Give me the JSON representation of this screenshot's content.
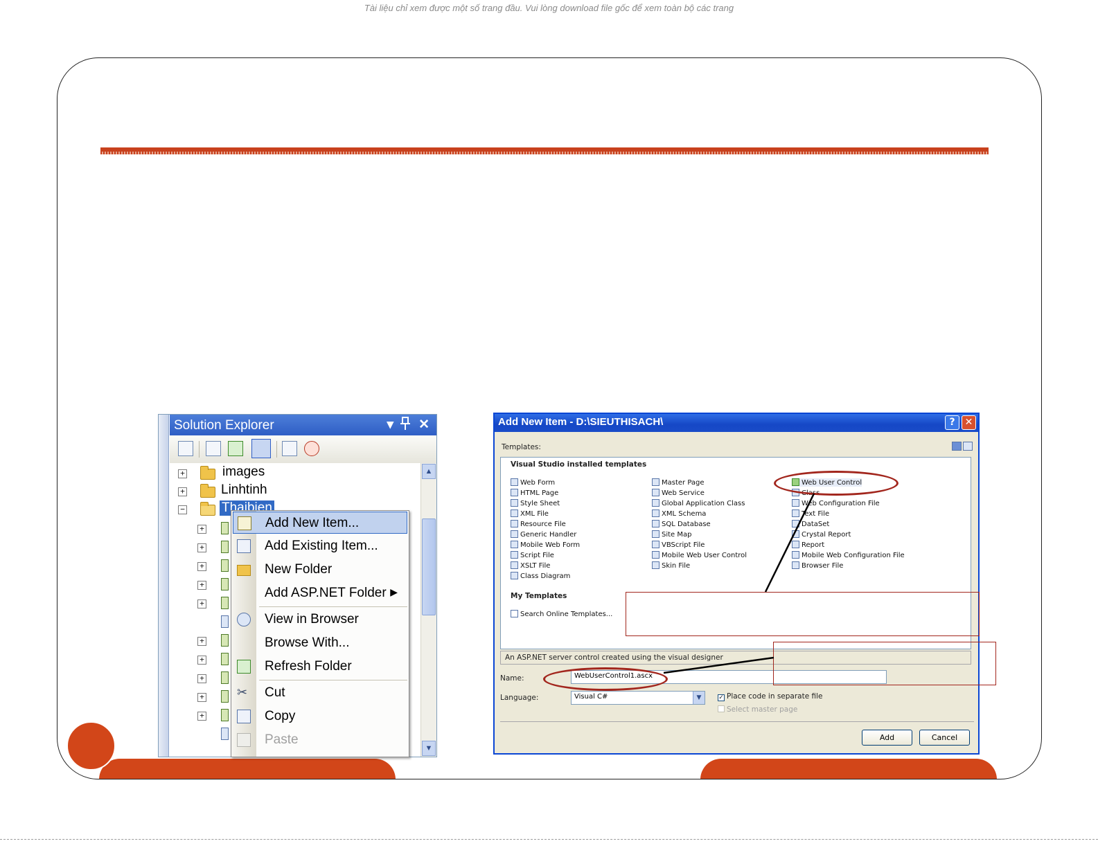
{
  "watermark": "Tài liệu chỉ xem được một số trang đầu. Vui lòng download file gốc để xem toàn bộ các trang",
  "solution_explorer": {
    "title": "Solution Explorer",
    "title_buttons": [
      "▾",
      "ᵖ",
      "✕"
    ],
    "tree": [
      {
        "label": "images",
        "type": "folder",
        "expander": "+"
      },
      {
        "label": "Linhtinh",
        "type": "folder",
        "expander": "+"
      },
      {
        "label": "Thaibien",
        "type": "folder-open",
        "expander": "−",
        "selected": true
      }
    ],
    "scroll_up": "▲",
    "scroll_down": "▼"
  },
  "context_menu": {
    "items": [
      {
        "label": "Add New Item...",
        "icon": "add-new-item-icon"
      },
      {
        "label": "Add Existing Item...",
        "icon": "add-existing-item-icon"
      },
      {
        "label": "New Folder",
        "icon": "new-folder-icon"
      },
      {
        "label": "Add ASP.NET Folder",
        "icon": "",
        "submenu": "▶"
      },
      {
        "label": "View in Browser",
        "icon": "view-in-browser-icon"
      },
      {
        "label": "Browse With...",
        "icon": ""
      },
      {
        "label": "Refresh Folder",
        "icon": "refresh-icon"
      },
      {
        "label": "Cut",
        "icon": "scissors-icon"
      },
      {
        "label": "Copy",
        "icon": "copy-icon"
      },
      {
        "label": "Paste",
        "icon": "paste-icon",
        "disabled": true
      }
    ]
  },
  "dialog": {
    "title": "Add New Item - D:\\SIEUTHISACH\\",
    "help": "?",
    "close": "✕",
    "templates_label": "Templates:",
    "installed_label": "Visual Studio installed templates",
    "col1": [
      "Web Form",
      "HTML Page",
      "Style Sheet",
      "XML File",
      "Resource File",
      "Generic Handler",
      "Mobile Web Form",
      "Script File",
      "XSLT File",
      "Class Diagram"
    ],
    "col2": [
      "Master Page",
      "Web Service",
      "Global Application Class",
      "XML Schema",
      "SQL Database",
      "Site Map",
      "VBScript File",
      "Mobile Web User Control",
      "Skin File"
    ],
    "col3": [
      "Web User Control",
      "Class",
      "Web Configuration File",
      "Text File",
      "DataSet",
      "Crystal Report",
      "Report",
      "Mobile Web Configuration File",
      "Browser File"
    ],
    "my_templates_label": "My Templates",
    "search_online": "Search Online Templates...",
    "description": "An ASP.NET server control created using the visual designer",
    "name_label": "Name:",
    "name_value": "WebUserControl1.ascx",
    "language_label": "Language:",
    "language_value": "Visual C#",
    "place_code_label": "Place code in separate file",
    "select_master_label": "Select master page",
    "add_button": "Add",
    "cancel_button": "Cancel"
  },
  "colors": {
    "accent": "#d24619",
    "annotation": "#a2261d",
    "xp_blue": "#0a46d4"
  }
}
